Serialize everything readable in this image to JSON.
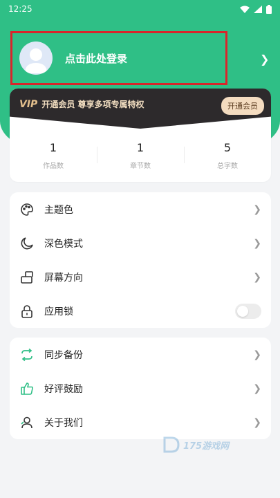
{
  "status_bar": {
    "time": "12:25"
  },
  "login": {
    "label": "点击此处登录"
  },
  "vip": {
    "logo": "VIP",
    "text": "开通会员 尊享多项专属特权",
    "button": "开通会员"
  },
  "stats": [
    {
      "value": "1",
      "label": "作品数"
    },
    {
      "value": "1",
      "label": "章节数"
    },
    {
      "value": "5",
      "label": "总字数"
    }
  ],
  "settings": [
    {
      "label": "主题色",
      "icon": "palette-icon"
    },
    {
      "label": "深色模式",
      "icon": "moon-icon"
    },
    {
      "label": "屏幕方向",
      "icon": "screen-rotation-icon"
    },
    {
      "label": "应用锁",
      "icon": "lock-icon"
    }
  ],
  "more": [
    {
      "label": "同步备份",
      "icon": "sync-icon"
    },
    {
      "label": "好评鼓励",
      "icon": "thumbs-up-icon"
    },
    {
      "label": "关于我们",
      "icon": "person-icon"
    }
  ],
  "watermark": {
    "text": "175游戏网"
  },
  "colors": {
    "accent": "#2fbf86",
    "vip_bg": "#2d2a2c",
    "highlight_border": "#d9252b"
  }
}
